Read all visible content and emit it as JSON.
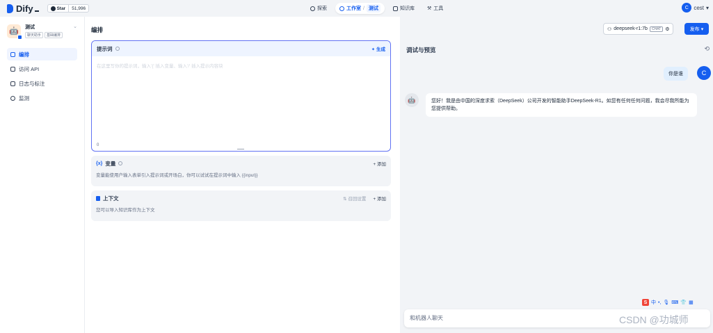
{
  "topbar": {
    "logo": "Dify",
    "star_label": "Star",
    "star_count": "51,996",
    "nav": [
      {
        "label": "探索"
      },
      {
        "label": "工作室",
        "sub": "测试"
      },
      {
        "label": "知识库"
      },
      {
        "label": "工具"
      }
    ],
    "user_initial": "C",
    "user_name": "cest"
  },
  "sidebar": {
    "app_name": "测试",
    "app_tags": [
      "聊天助手",
      "基础编排"
    ],
    "items": [
      {
        "label": "编排",
        "active": true
      },
      {
        "label": "访问 API"
      },
      {
        "label": "日志与标注"
      },
      {
        "label": "监测"
      }
    ]
  },
  "editor": {
    "title": "编排",
    "prompt": {
      "label": "提示词",
      "generate": "生成",
      "placeholder": "在这里写你的提示词，输入'{' 插入变量、输入'/' 插入提示内容块",
      "count": "0"
    },
    "variables": {
      "label": "变量",
      "add": "+ 添加",
      "desc": "变量能使用户输入表单引入提示词或开场白，你可以试试在提示词中输入 {{input}}"
    },
    "context": {
      "label": "上下文",
      "recall": "召回设置",
      "add": "+ 添加",
      "desc": "您可以导入知识库作为上下文"
    }
  },
  "header_actions": {
    "model": "deepseek-r1:7b",
    "model_tag": "CHAT",
    "publish": "发布"
  },
  "debug": {
    "title": "调试与预览",
    "user_message": "你是谁",
    "user_initial": "C",
    "bot_message": "您好！我是由中国的深度求索（DeepSeek）公司开发的智能助手DeepSeek-R1。如您有任何任何问题，我会尽我所能为您提供帮助。",
    "input_placeholder": "和机器人聊天",
    "ime_label": "中"
  },
  "watermark": "CSDN @功城师",
  "colors": {
    "accent": "#155eef",
    "prompt_border": "#6172f3"
  }
}
